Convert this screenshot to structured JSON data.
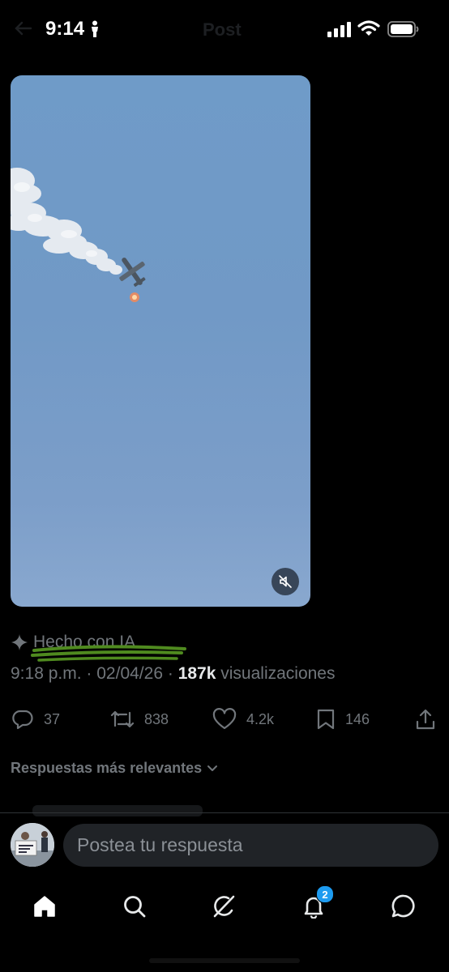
{
  "status_bar": {
    "time": "9:14",
    "faded_title": "Post",
    "icons": [
      "person-icon",
      "signal-icon",
      "wifi-icon",
      "battery-icon"
    ]
  },
  "media": {
    "type": "video",
    "description_icon": "mute-icon",
    "sky_color": "#7199c6"
  },
  "post": {
    "ai_label": "Hecho con IA",
    "ai_icon": "sparkle-icon",
    "highlight_color": "#4f8a1f",
    "time": "9:18 p.m.",
    "separator": "·",
    "date": "02/04/26",
    "views_count": "187k",
    "views_label": "visualizaciones"
  },
  "actions": {
    "replies": "37",
    "reposts": "838",
    "likes": "4.2k",
    "bookmarks": "146",
    "icons": [
      "reply-icon",
      "repost-icon",
      "like-icon",
      "bookmark-icon",
      "share-icon"
    ]
  },
  "replies_sort": {
    "label": "Respuestas más relevantes",
    "icon": "chevron-down-icon"
  },
  "composer": {
    "placeholder": "Postea tu respuesta"
  },
  "nav": {
    "items": [
      "home-icon",
      "search-icon",
      "grok-icon",
      "notifications-icon",
      "messages-icon"
    ],
    "notifications_badge": "2",
    "accent": "#1d9bf0"
  }
}
